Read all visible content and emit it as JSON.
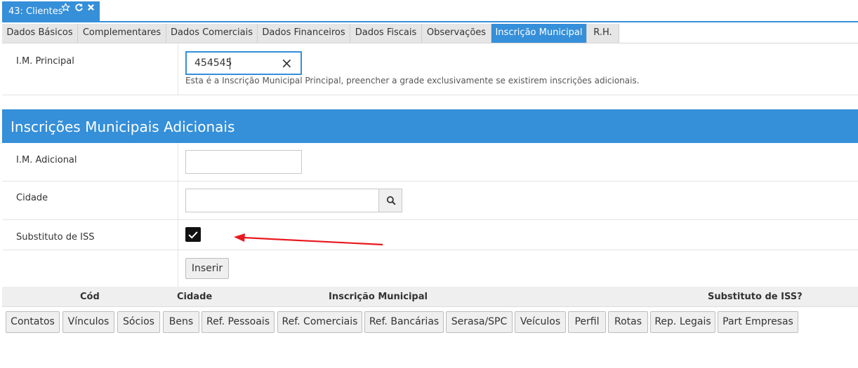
{
  "window": {
    "title": "43: Clientes",
    "icons": [
      "star-icon",
      "refresh-icon",
      "close-icon"
    ],
    "accent": "#358fd9"
  },
  "tabs": [
    {
      "label": "Dados Básicos",
      "active": false
    },
    {
      "label": "Complementares",
      "active": false
    },
    {
      "label": "Dados Comerciais",
      "active": false
    },
    {
      "label": "Dados Financeiros",
      "active": false
    },
    {
      "label": "Dados Fiscais",
      "active": false
    },
    {
      "label": "Observações",
      "active": false
    },
    {
      "label": "Inscrição Municipal",
      "active": true
    },
    {
      "label": "R.H.",
      "active": false
    }
  ],
  "principal": {
    "label": "I.M. Principal",
    "value": "454545",
    "clear_icon": "×",
    "help": "Esta é a Inscrição Municipal Principal, preencher a grade exclusivamente se existirem inscrições adicionais."
  },
  "section_title": "Inscrições Municipais Adicionais",
  "adicional": {
    "label": "I.M. Adicional",
    "value": ""
  },
  "cidade": {
    "label": "Cidade",
    "value": "",
    "icon": "search-icon"
  },
  "substituto": {
    "label": "Substituto de ISS",
    "checked": true
  },
  "insert_button": "Inserir",
  "grid_headers": [
    "Cód",
    "Cidade",
    "Inscrição Municipal",
    "Substituto de ISS?"
  ],
  "bottom_buttons": [
    "Contatos",
    "Vínculos",
    "Sócios",
    "Bens",
    "Ref. Pessoais",
    "Ref. Comerciais",
    "Ref. Bancárias",
    "Serasa/SPC",
    "Veículos",
    "Perfil",
    "Rotas",
    "Rep. Legais",
    "Part Empresas"
  ],
  "annotation_arrow_color": "#e8191e"
}
